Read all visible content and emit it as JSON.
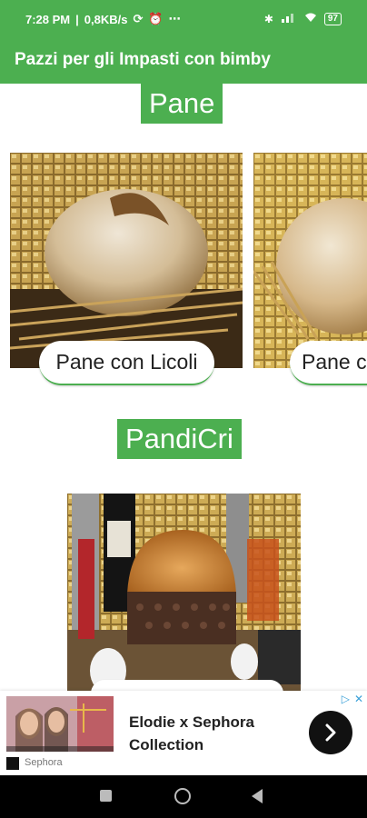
{
  "status_bar": {
    "time": "7:28 PM",
    "network_speed": "0,8KB/s",
    "battery": "97",
    "icons": [
      "sync-icon",
      "alarm-icon",
      "more-icon",
      "bluetooth-icon",
      "signal-icon",
      "wifi-icon",
      "battery-icon"
    ]
  },
  "app_bar": {
    "title": "Pazzi per gli Impasti con bimby"
  },
  "sections": [
    {
      "category": "Pane",
      "cards": [
        {
          "title": "Pane con Licoli"
        },
        {
          "title": "Pane c"
        }
      ]
    },
    {
      "category": "PandiCri",
      "cards": [
        {
          "title": ""
        }
      ]
    }
  ],
  "ad": {
    "title": "Elodie x Sephora Collection",
    "brand": "Sephora",
    "choices_icons": [
      "ad-choices-icon",
      "close-icon"
    ],
    "cta_icon": "chevron-right-icon"
  },
  "nav_bar": {
    "icons": [
      "recents-icon",
      "home-icon",
      "back-icon"
    ]
  },
  "colors": {
    "primary": "#4caf50",
    "on_primary": "#ffffff",
    "ad_cta": "#111111",
    "nav_bar": "#000000"
  }
}
